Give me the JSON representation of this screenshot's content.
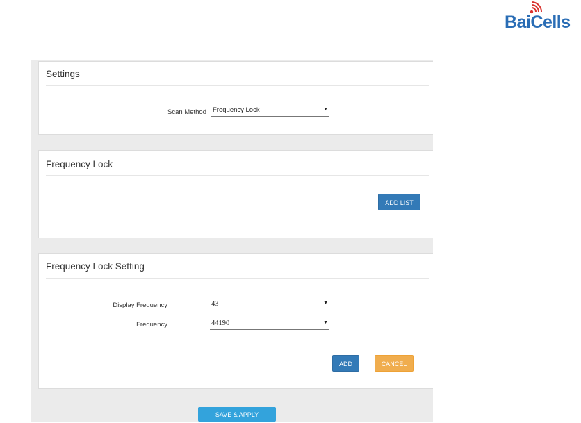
{
  "brand": {
    "logo_text": "BaiCells",
    "logo_color": "#2a6db5"
  },
  "settings_panel": {
    "title": "Settings",
    "scan_method_label": "Scan Method",
    "scan_method_value": "Frequency Lock"
  },
  "frequency_lock_panel": {
    "title": "Frequency Lock",
    "add_list_label": "ADD LIST"
  },
  "frequency_lock_setting_panel": {
    "title": "Frequency Lock Setting",
    "display_frequency_label": "Display Frequency",
    "display_frequency_value": "43",
    "frequency_label": "Frequency",
    "frequency_value": "44190",
    "add_label": "ADD",
    "cancel_label": "CANCEL"
  },
  "footer": {
    "save_apply_label": "SAVE & APPLY"
  },
  "colors": {
    "primary_button": "#337ab7",
    "warning_button": "#f0ad4e",
    "save_button": "#33a3dc",
    "page_background": "#ebebeb"
  }
}
